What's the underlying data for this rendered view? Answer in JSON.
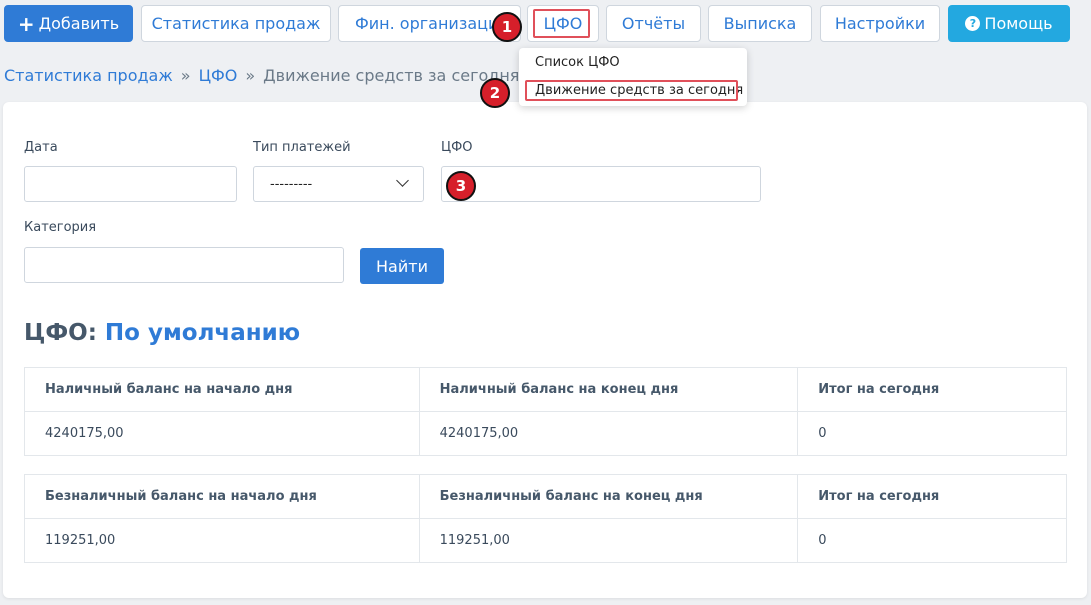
{
  "toolbar": {
    "add_label": "Добавить",
    "sales_stats": "Статистика продаж",
    "fin_orgs": "Фин. организации",
    "cfo": "ЦФО",
    "reports": "Отчёты",
    "statement": "Выписка",
    "settings": "Настройки",
    "help": "Помощь"
  },
  "breadcrumb": {
    "item1": "Статистика продаж",
    "item2": "ЦФО",
    "current": "Движение средств за сегодня",
    "separator": "»"
  },
  "dropdown": {
    "items": [
      "Список ЦФО",
      "Движение средств за сегодня"
    ]
  },
  "badges": [
    "1",
    "2",
    "3"
  ],
  "filters": {
    "date_label": "Дата",
    "date_value": "",
    "payment_type_label": "Тип платежей",
    "payment_type_value": "---------",
    "cfo_label": "ЦФО",
    "cfo_value": "",
    "category_label": "Категория",
    "category_value": "",
    "find_button": "Найти"
  },
  "heading": {
    "prefix": "ЦФО:",
    "value": "По умолчанию"
  },
  "cash_table": {
    "headers": [
      "Наличный баланс на начало дня",
      "Наличный баланс на конец дня",
      "Итог на сегодня"
    ],
    "values": [
      "4240175,00",
      "4240175,00",
      "0"
    ]
  },
  "noncash_table": {
    "headers": [
      "Безналичный баланс на начало дня",
      "Безналичный баланс на конец дня",
      "Итог на сегодня"
    ],
    "values": [
      "119251,00",
      "119251,00",
      "0"
    ]
  },
  "colors": {
    "primary": "#2f7bd6",
    "help": "#23a8e0",
    "highlight": "#e0505a",
    "badge": "#d61f2a"
  }
}
